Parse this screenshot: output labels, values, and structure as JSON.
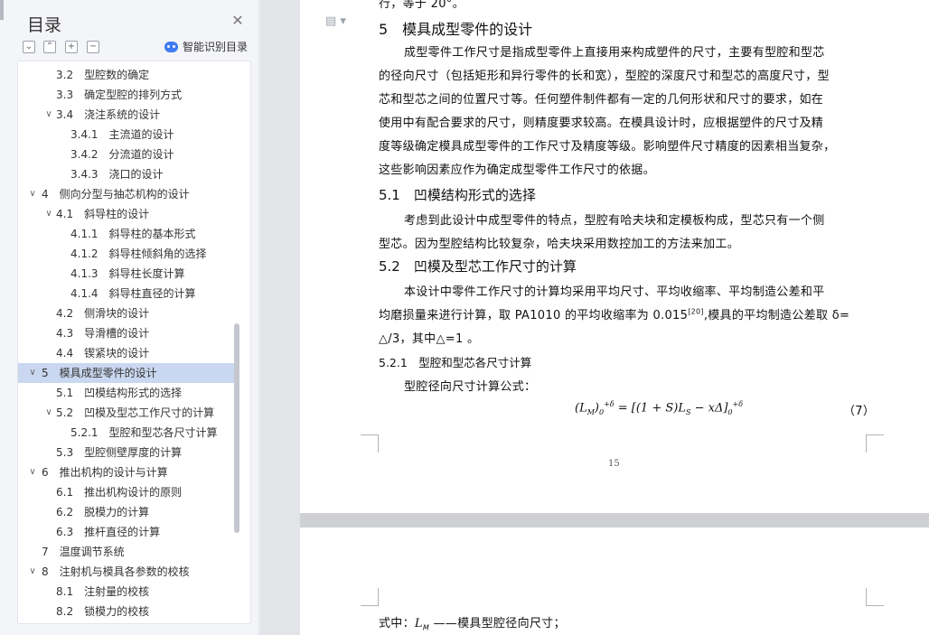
{
  "sidebar": {
    "title": "目录",
    "smart_toc_label": "智能识别目录",
    "toc": [
      {
        "label": "3.2　型腔数的确定",
        "level": 1,
        "toggle": ""
      },
      {
        "label": "3.3　确定型腔的排列方式",
        "level": 1,
        "toggle": ""
      },
      {
        "label": "3.4　浇注系统的设计",
        "level": 1,
        "toggle": "∨"
      },
      {
        "label": "3.4.1　主流道的设计",
        "level": 2,
        "toggle": ""
      },
      {
        "label": "3.4.2　分流道的设计",
        "level": 2,
        "toggle": ""
      },
      {
        "label": "3.4.3　浇口的设计",
        "level": 2,
        "toggle": ""
      },
      {
        "label": "4　侧向分型与抽芯机构的设计",
        "level": 0,
        "toggle": "∨"
      },
      {
        "label": "4.1　斜导柱的设计",
        "level": 1,
        "toggle": "∨"
      },
      {
        "label": "4.1.1　斜导柱的基本形式",
        "level": 2,
        "toggle": ""
      },
      {
        "label": "4.1.2　斜导柱倾斜角的选择",
        "level": 2,
        "toggle": ""
      },
      {
        "label": "4.1.3　斜导柱长度计算",
        "level": 2,
        "toggle": ""
      },
      {
        "label": "4.1.4　斜导柱直径的计算",
        "level": 2,
        "toggle": ""
      },
      {
        "label": "4.2　侧滑块的设计",
        "level": 1,
        "toggle": ""
      },
      {
        "label": "4.3　导滑槽的设计",
        "level": 1,
        "toggle": ""
      },
      {
        "label": "4.4　锲紧块的设计",
        "level": 1,
        "toggle": ""
      },
      {
        "label": "5　模具成型零件的设计",
        "level": 0,
        "toggle": "∨",
        "selected": true
      },
      {
        "label": "5.1　凹模结构形式的选择",
        "level": 1,
        "toggle": ""
      },
      {
        "label": "5.2　凹模及型芯工作尺寸的计算",
        "level": 1,
        "toggle": "∨"
      },
      {
        "label": "5.2.1　型腔和型芯各尺寸计算",
        "level": 2,
        "toggle": ""
      },
      {
        "label": "5.3　型腔侧壁厚度的计算",
        "level": 1,
        "toggle": ""
      },
      {
        "label": "6　推出机构的设计与计算",
        "level": 0,
        "toggle": "∨"
      },
      {
        "label": "6.1　推出机构设计的原则",
        "level": 1,
        "toggle": ""
      },
      {
        "label": "6.2　脱模力的计算",
        "level": 1,
        "toggle": ""
      },
      {
        "label": "6.3　推杆直径的计算",
        "level": 1,
        "toggle": ""
      },
      {
        "label": "7　温度调节系统",
        "level": 0,
        "toggle": ""
      },
      {
        "label": "8　注射机与模具各参数的校核",
        "level": 0,
        "toggle": "∨"
      },
      {
        "label": "8.1　注射量的校核",
        "level": 1,
        "toggle": ""
      },
      {
        "label": "8.2　锁模力的校核",
        "level": 1,
        "toggle": ""
      }
    ]
  },
  "document": {
    "top_fragment": "行，等于 20°。",
    "h1": "5　模具成型零件的设计",
    "p1": [
      "成型零件工作尺寸是指成型零件上直接用来构成塑件的尺寸，主要有型腔和型芯",
      "的径向尺寸（包括矩形和异行零件的长和宽），型腔的深度尺寸和型芯的高度尺寸，型",
      "芯和型芯之间的位置尺寸等。任何塑件制件都有一定的几何形状和尺寸的要求，如在",
      "使用中有配合要求的尺寸，则精度要求较高。在模具设计时，应根据塑件的尺寸及精",
      "度等级确定模具成型零件的工作尺寸及精度等级。影响塑件尺寸精度的因素相当复杂，",
      "这些影响因素应作为确定成型零件工作尺寸的依据。"
    ],
    "h2_1": "5.1　凹模结构形式的选择",
    "p2": [
      "考虑到此设计中成型零件的特点，型腔有哈夫块和定模板构成，型芯只有一个侧",
      "型芯。因为型腔结构比较复杂，哈夫块采用数控加工的方法来加工。"
    ],
    "h2_2": "5.2　凹模及型芯工作尺寸的计算",
    "p3_line1": "本设计中零件工作尺寸的计算均采用平均尺寸、平均收缩率、平均制造公差和平",
    "p3_line2a": "均磨损量来进行计算，取 PA1010 的平均收缩率为 0.015",
    "p3_ref": "[20]",
    "p3_line2b": ",模具的平均制造公差取 δ=",
    "p3_line3": "△/3，其中△=1 。",
    "h3": "5.2.1　型腔和型芯各尺寸计算",
    "formula_intro": "型腔径向尺寸计算公式：",
    "formula": "(L_M)_0^{+δ} = [(1+S)L_S − xΔ]_0^{+δ}",
    "formula_lhs": "(L",
    "formula_rhs": "= [(1 + S)L",
    "formula_rhs2": " − xΔ]",
    "formula_sub_M": "M",
    "formula_sub_S": "S",
    "formula_sup": "+δ",
    "formula_zero": "0",
    "formula_num": "（7）",
    "page_number": "15",
    "page2_line_a": "式中：",
    "page2_line_var": "L",
    "page2_line_sub": "M",
    "page2_line_b": " ——模具型腔径向尺寸；"
  },
  "icons": {
    "close": "close-icon",
    "collapse": "collapse-all-icon",
    "expand_up": "chevron-up-icon",
    "add": "add-heading-icon",
    "remove": "remove-heading-icon",
    "doc": "document-icon"
  }
}
